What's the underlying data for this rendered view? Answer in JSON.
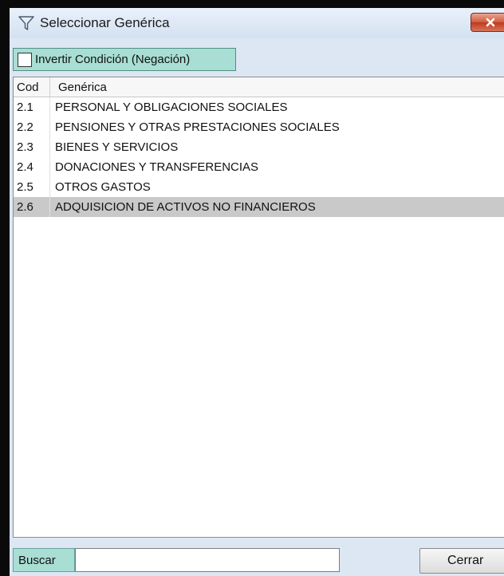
{
  "window": {
    "title": "Seleccionar Genérica",
    "icon": "filter-icon",
    "close_icon": "close-icon"
  },
  "toolbar": {
    "negation_label": "Invertir Condición (Negación)",
    "negation_checked": false
  },
  "grid": {
    "headers": {
      "cod": "Cod",
      "generica": "Genérica"
    },
    "rows": [
      {
        "cod": "2.1",
        "name": "PERSONAL Y OBLIGACIONES SOCIALES"
      },
      {
        "cod": "2.2",
        "name": "PENSIONES Y OTRAS PRESTACIONES SOCIALES"
      },
      {
        "cod": "2.3",
        "name": "BIENES Y SERVICIOS"
      },
      {
        "cod": "2.4",
        "name": "DONACIONES Y TRANSFERENCIAS"
      },
      {
        "cod": "2.5",
        "name": "OTROS GASTOS"
      },
      {
        "cod": "2.6",
        "name": "ADQUISICION DE ACTIVOS NO FINANCIEROS"
      }
    ],
    "selected_row": "2.6"
  },
  "footer": {
    "search_label": "Buscar",
    "search_value": "",
    "close_label": "Cerrar"
  },
  "colors": {
    "accent_teal": "#a8ded4",
    "selection_gray": "#c9c9c9",
    "close_red": "#cf5a3e"
  }
}
